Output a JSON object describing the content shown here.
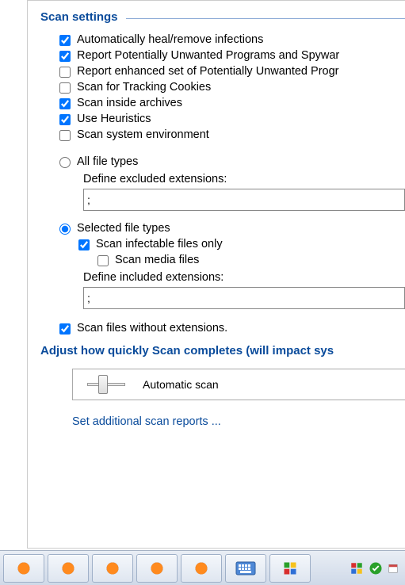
{
  "section_title": "Scan settings",
  "checkboxes": [
    {
      "label": "Automatically heal/remove infections",
      "checked": true
    },
    {
      "label": "Report Potentially Unwanted Programs and Spywar",
      "checked": true
    },
    {
      "label": "Report enhanced set of Potentially Unwanted Progr",
      "checked": false
    },
    {
      "label": "Scan for Tracking Cookies",
      "checked": false
    },
    {
      "label": "Scan inside archives",
      "checked": true
    },
    {
      "label": "Use Heuristics",
      "checked": true
    },
    {
      "label": "Scan system environment",
      "checked": false
    }
  ],
  "radio_all": {
    "label": "All file types",
    "selected": false
  },
  "excluded_label": "Define excluded extensions:",
  "excluded_value": ";",
  "radio_selected": {
    "label": "Selected file types",
    "selected": true
  },
  "infectable": {
    "label": "Scan infectable files only",
    "checked": true
  },
  "media": {
    "label": "Scan media files",
    "checked": false
  },
  "included_label": "Define included extensions:",
  "included_value": ";",
  "no_ext": {
    "label": "Scan files without extensions.",
    "checked": true
  },
  "adjust_title": "Adjust how quickly Scan completes (will impact sys",
  "slider_label": "Automatic scan",
  "link_text": "Set additional scan reports ..."
}
